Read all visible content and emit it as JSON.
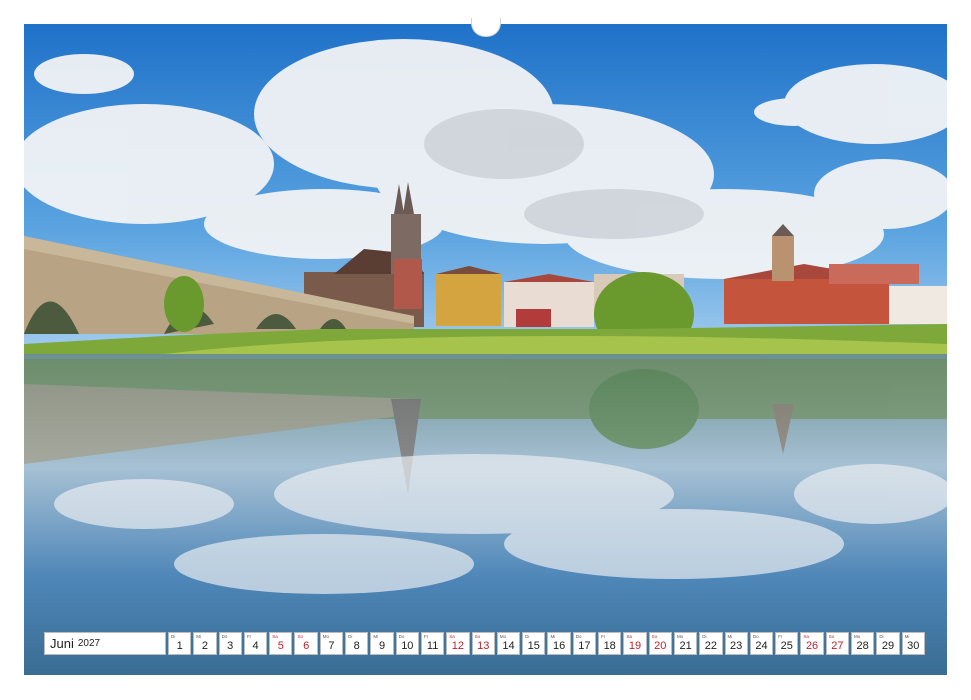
{
  "calendar": {
    "month": "Juni",
    "year": "2027",
    "days": [
      {
        "wd": "Di",
        "d": "1",
        "we": false
      },
      {
        "wd": "Mi",
        "d": "2",
        "we": false
      },
      {
        "wd": "Do",
        "d": "3",
        "we": false
      },
      {
        "wd": "Fr",
        "d": "4",
        "we": false
      },
      {
        "wd": "Sa",
        "d": "5",
        "we": true
      },
      {
        "wd": "So",
        "d": "6",
        "we": true
      },
      {
        "wd": "Mo",
        "d": "7",
        "we": false
      },
      {
        "wd": "Di",
        "d": "8",
        "we": false
      },
      {
        "wd": "Mi",
        "d": "9",
        "we": false
      },
      {
        "wd": "Do",
        "d": "10",
        "we": false
      },
      {
        "wd": "Fr",
        "d": "11",
        "we": false
      },
      {
        "wd": "Sa",
        "d": "12",
        "we": true
      },
      {
        "wd": "So",
        "d": "13",
        "we": true
      },
      {
        "wd": "Mo",
        "d": "14",
        "we": false
      },
      {
        "wd": "Di",
        "d": "15",
        "we": false
      },
      {
        "wd": "Mi",
        "d": "16",
        "we": false
      },
      {
        "wd": "Do",
        "d": "17",
        "we": false
      },
      {
        "wd": "Fr",
        "d": "18",
        "we": false
      },
      {
        "wd": "Sa",
        "d": "19",
        "we": true
      },
      {
        "wd": "So",
        "d": "20",
        "we": true
      },
      {
        "wd": "Mo",
        "d": "21",
        "we": false
      },
      {
        "wd": "Di",
        "d": "22",
        "we": false
      },
      {
        "wd": "Mi",
        "d": "23",
        "we": false
      },
      {
        "wd": "Do",
        "d": "24",
        "we": false
      },
      {
        "wd": "Fr",
        "d": "25",
        "we": false
      },
      {
        "wd": "Sa",
        "d": "26",
        "we": true
      },
      {
        "wd": "So",
        "d": "27",
        "we": true
      },
      {
        "wd": "Mo",
        "d": "28",
        "we": false
      },
      {
        "wd": "Di",
        "d": "29",
        "we": false
      },
      {
        "wd": "Mi",
        "d": "30",
        "we": false
      }
    ]
  },
  "colors": {
    "weekend": "#c0202a",
    "sky": "#2a7fcf",
    "water": "#5d8aa8"
  }
}
